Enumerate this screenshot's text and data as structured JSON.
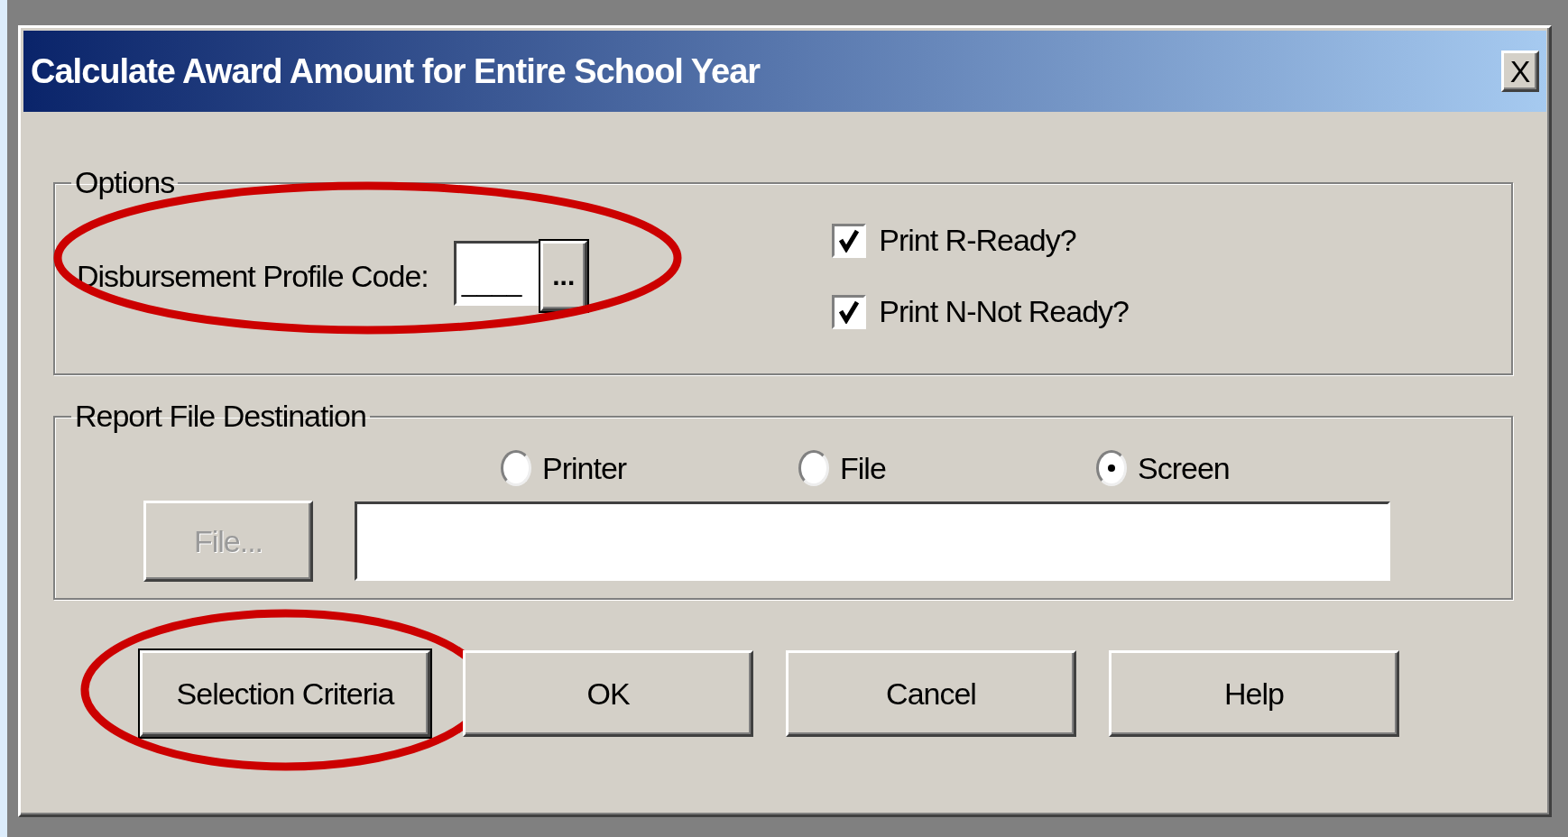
{
  "window": {
    "title": "Calculate Award Amount for Entire School Year",
    "close_label": "X"
  },
  "options": {
    "label": "Options",
    "profile_code": {
      "label": "Disbursement Profile Code:",
      "value": "____",
      "browse_label": "...",
      "circled": true
    },
    "checkboxes": [
      {
        "label": "Print R-Ready?",
        "checked": true
      },
      {
        "label": "Print N-Not Ready?",
        "checked": true
      }
    ]
  },
  "destination": {
    "label": "Report File Destination",
    "radios": [
      {
        "label": "Printer",
        "selected": false
      },
      {
        "label": "File",
        "selected": false
      },
      {
        "label": "Screen",
        "selected": true
      }
    ],
    "file_button": {
      "label": "File...",
      "disabled": true
    }
  },
  "buttons": [
    {
      "label": "Selection Criteria",
      "circled": true,
      "default": true
    },
    {
      "label": "OK",
      "circled": false,
      "default": false
    },
    {
      "label": "Cancel",
      "circled": false,
      "default": false
    },
    {
      "label": "Help",
      "circled": false,
      "default": false
    }
  ]
}
